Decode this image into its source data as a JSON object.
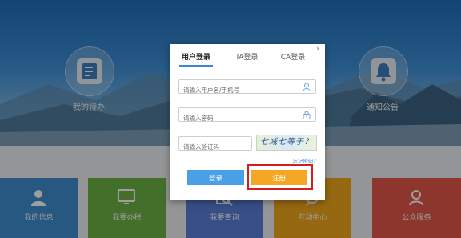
{
  "background": {
    "circles": [
      {
        "label": "我的待办",
        "icon": "todo-list-icon"
      },
      {
        "label": "通知公告",
        "icon": "bell-icon"
      }
    ],
    "tiles": [
      {
        "label": "我的信息",
        "icon": "user-icon",
        "color": "#3f8fd2"
      },
      {
        "label": "我要办税",
        "icon": "monitor-icon",
        "color": "#6db345"
      },
      {
        "label": "我要查询",
        "icon": "search-document-icon",
        "color": "#5a7fd8"
      },
      {
        "label": "互动中心",
        "icon": "chat-icon",
        "color": "#f0a81c"
      },
      {
        "label": "公众服务",
        "icon": "public-service-icon",
        "color": "#e4574a"
      }
    ]
  },
  "dialog": {
    "close": "x",
    "tabs": [
      {
        "label": "用户登录",
        "active": true
      },
      {
        "label": "IA登录",
        "active": false
      },
      {
        "label": "CA登录",
        "active": false
      }
    ],
    "username_placeholder": "请输入用户名/手机号",
    "password_placeholder": "请输入密码",
    "captcha_placeholder": "请输入验证码",
    "captcha_text": "七减七等于？",
    "forgot_password": "忘记密码？",
    "login_label": "登录",
    "register_label": "注册"
  },
  "colors": {
    "accent": "#3b86d6",
    "login_button": "#4aa0e6",
    "register_button": "#f5a623",
    "highlight": "#d61c1c"
  }
}
